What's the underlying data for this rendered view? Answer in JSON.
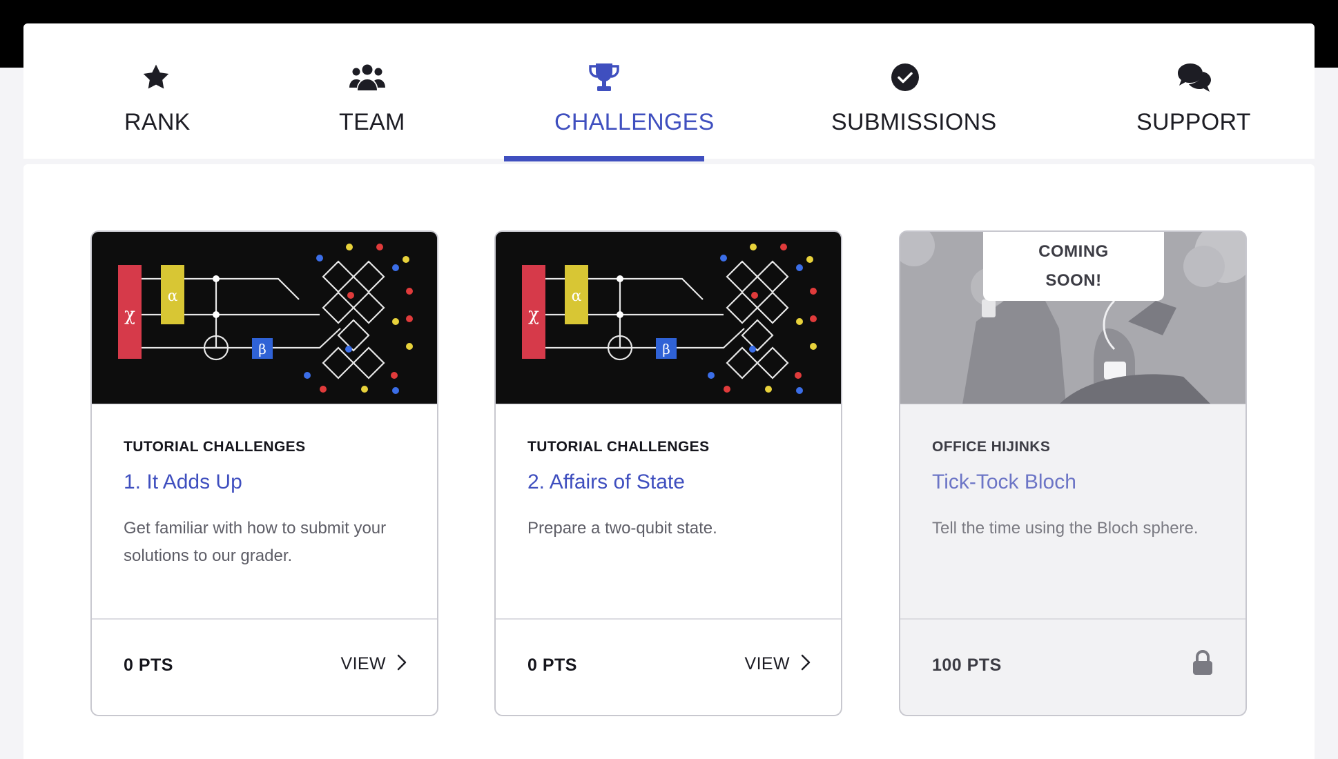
{
  "nav": {
    "items": [
      {
        "label": "RANK",
        "icon": "star-icon"
      },
      {
        "label": "TEAM",
        "icon": "users-icon"
      },
      {
        "label": "CHALLENGES",
        "icon": "trophy-icon",
        "active": true
      },
      {
        "label": "SUBMISSIONS",
        "icon": "check-circle-icon"
      },
      {
        "label": "SUPPORT",
        "icon": "chat-bubbles-icon"
      }
    ]
  },
  "cards": [
    {
      "category": "TUTORIAL CHALLENGES",
      "title": "1. It Adds Up",
      "description": "Get familiar with how to submit your solutions to our grader.",
      "points": "0 PTS",
      "action": "VIEW",
      "image": "quantum-circuit-image",
      "image_text": {
        "chi": "χ",
        "alpha": "α",
        "beta": "β"
      }
    },
    {
      "category": "TUTORIAL CHALLENGES",
      "title": "2. Affairs of State",
      "description": "Prepare a two-qubit state.",
      "points": "0 PTS",
      "action": "VIEW",
      "image": "quantum-circuit-image",
      "image_text": {
        "chi": "χ",
        "alpha": "α",
        "beta": "β"
      }
    },
    {
      "category": "OFFICE HIJINKS",
      "title": "Tick-Tock Bloch",
      "description": "Tell the time using the Bloch sphere.",
      "points": "100 PTS",
      "badge_line1": "COMING",
      "badge_line2": "SOON!",
      "locked": true,
      "image": "office-coffee-image"
    }
  ],
  "colors": {
    "accent": "#3f4fbf",
    "top_bar": "#000000",
    "background": "#f4f4f7"
  }
}
